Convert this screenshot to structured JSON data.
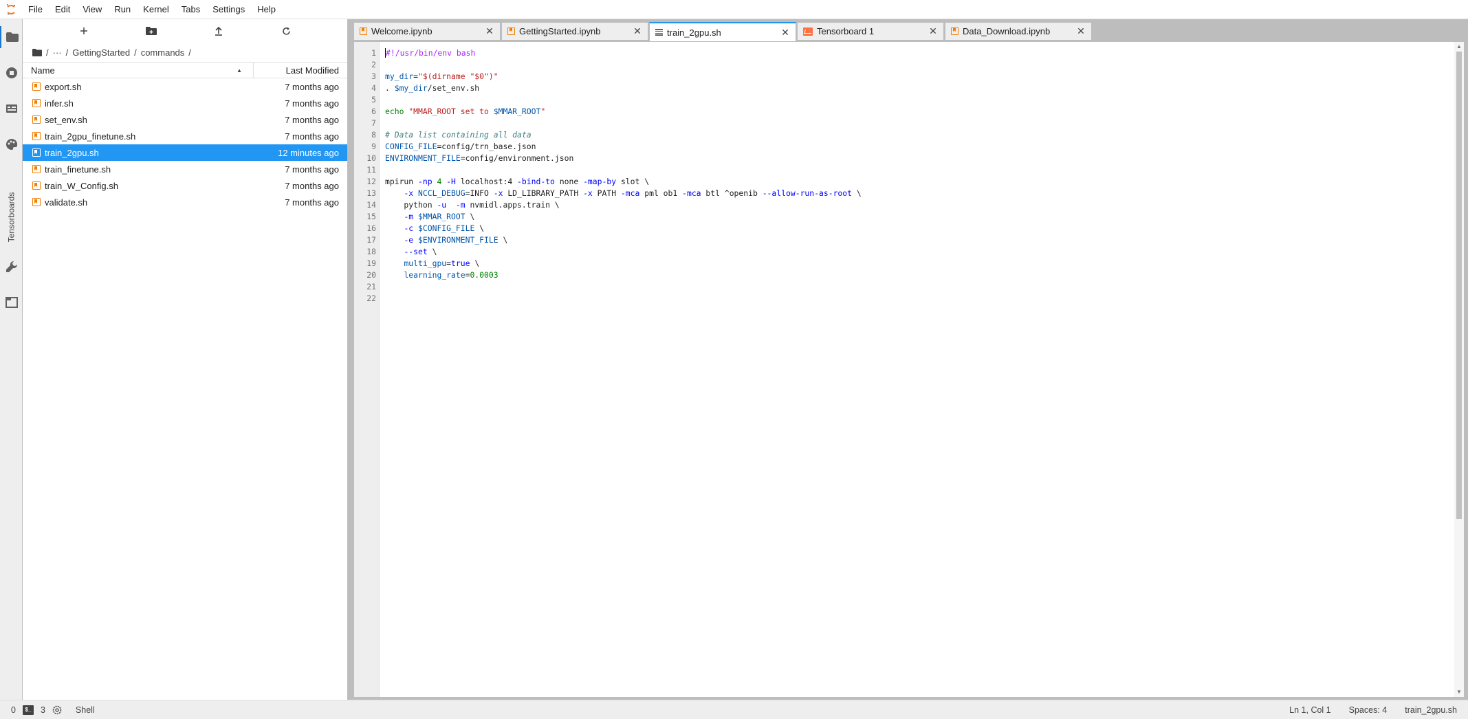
{
  "menu": [
    "File",
    "Edit",
    "View",
    "Run",
    "Kernel",
    "Tabs",
    "Settings",
    "Help"
  ],
  "activity": {
    "tensorboards_label": "Tensorboards"
  },
  "filebrowser": {
    "breadcrumb": [
      "/",
      "···",
      "/",
      "GettingStarted",
      "/",
      "commands",
      "/"
    ],
    "header_name": "Name",
    "header_modified": "Last Modified",
    "files": [
      {
        "name": "export.sh",
        "modified": "7 months ago",
        "selected": false
      },
      {
        "name": "infer.sh",
        "modified": "7 months ago",
        "selected": false
      },
      {
        "name": "set_env.sh",
        "modified": "7 months ago",
        "selected": false
      },
      {
        "name": "train_2gpu_finetune.sh",
        "modified": "7 months ago",
        "selected": false
      },
      {
        "name": "train_2gpu.sh",
        "modified": "12 minutes ago",
        "selected": true
      },
      {
        "name": "train_finetune.sh",
        "modified": "7 months ago",
        "selected": false
      },
      {
        "name": "train_W_Config.sh",
        "modified": "7 months ago",
        "selected": false
      },
      {
        "name": "validate.sh",
        "modified": "7 months ago",
        "selected": false
      }
    ]
  },
  "tabs": [
    {
      "label": "Welcome.ipynb",
      "icon": "notebook-icon",
      "active": false
    },
    {
      "label": "GettingStarted.ipynb",
      "icon": "notebook-icon",
      "active": false
    },
    {
      "label": "train_2gpu.sh",
      "icon": "text-file-icon",
      "active": true
    },
    {
      "label": "Tensorboard 1",
      "icon": "tensorboard-icon",
      "active": false
    },
    {
      "label": "Data_Download.ipynb",
      "icon": "notebook-icon",
      "active": false
    }
  ],
  "editor": {
    "line_numbers": [
      "1",
      "2",
      "3",
      "4",
      "5",
      "6",
      "7",
      "8",
      "9",
      "10",
      "11",
      "12",
      "13",
      "14",
      "15",
      "16",
      "17",
      "18",
      "19",
      "20",
      "21",
      "22"
    ]
  },
  "status": {
    "count_left": "0",
    "terminal_badge": "$_",
    "terminal_count": "3",
    "mode": "Shell",
    "cursor": "Ln 1, Col 1",
    "spaces": "Spaces: 4",
    "filename": "train_2gpu.sh"
  },
  "colors": {
    "accent": "#2196f3",
    "file_icon": "#f57c00"
  }
}
